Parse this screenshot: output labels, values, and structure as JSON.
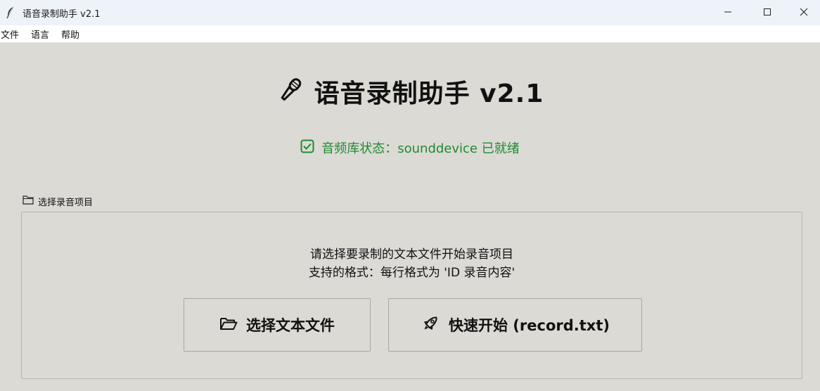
{
  "window": {
    "title": "语音录制助手 v2.1",
    "icon": "feather-icon"
  },
  "menu": {
    "items": [
      {
        "label": "文件"
      },
      {
        "label": "语言"
      },
      {
        "label": "帮助"
      }
    ]
  },
  "header": {
    "icon": "microphone-icon",
    "title": "语音录制助手 v2.1"
  },
  "status": {
    "icon": "check-box-icon",
    "text": "音频库状态：sounddevice 已就绪",
    "color": "#1f8a34"
  },
  "project_group": {
    "icon": "folder-icon",
    "label": "选择录音项目",
    "instruction_line1": "请选择要录制的文本文件开始录音项目",
    "instruction_line2": "支持的格式：每行格式为 'ID 录音内容'",
    "select_file_button": {
      "icon": "folder-open-icon",
      "label": "选择文本文件"
    },
    "quick_start_button": {
      "icon": "rocket-icon",
      "label": "快速开始 (record.txt)"
    }
  }
}
